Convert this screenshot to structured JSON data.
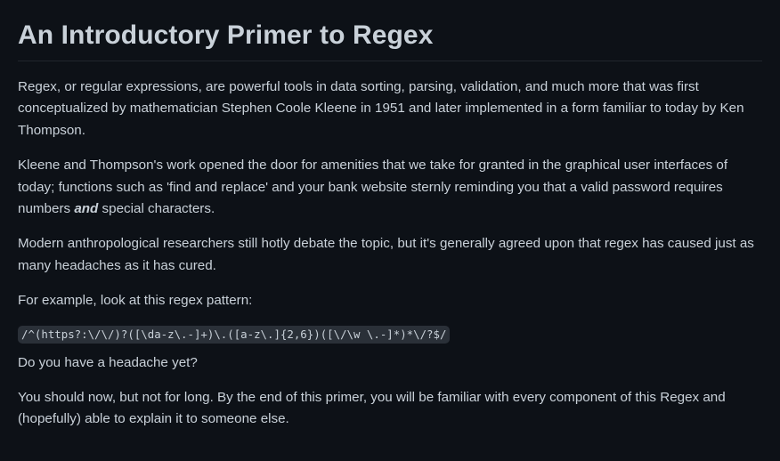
{
  "article": {
    "title": "An Introductory Primer to Regex",
    "para1": "Regex, or regular expressions, are powerful tools in data sorting, parsing, validation, and much more that was first conceptualized by mathematician Stephen Coole Kleene in 1951 and later implemented in a form familiar to today by Ken Thompson.",
    "para2_before": "Kleene and Thompson's work opened the door for amenities that we take for granted in the graphical user interfaces of today; functions such as 'find and replace' and your bank website sternly reminding you that a valid password requires numbers ",
    "para2_em": "and",
    "para2_after": " special characters.",
    "para3": "Modern anthropological researchers still hotly debate the topic, but it's generally agreed upon that regex has caused just as many headaches as it has cured.",
    "para4": "For example, look at this regex pattern:",
    "regex_code": "/^(https?:\\/\\/)?([\\da-z\\.-]+)\\.([a-z\\.]{2,6})([\\/\\w \\.-]*)*\\/?$/",
    "para5": "Do you have a headache yet?",
    "para6": "You should now, but not for long. By the end of this primer, you will be familiar with every component of this Regex and (hopefully) able to explain it to someone else."
  }
}
